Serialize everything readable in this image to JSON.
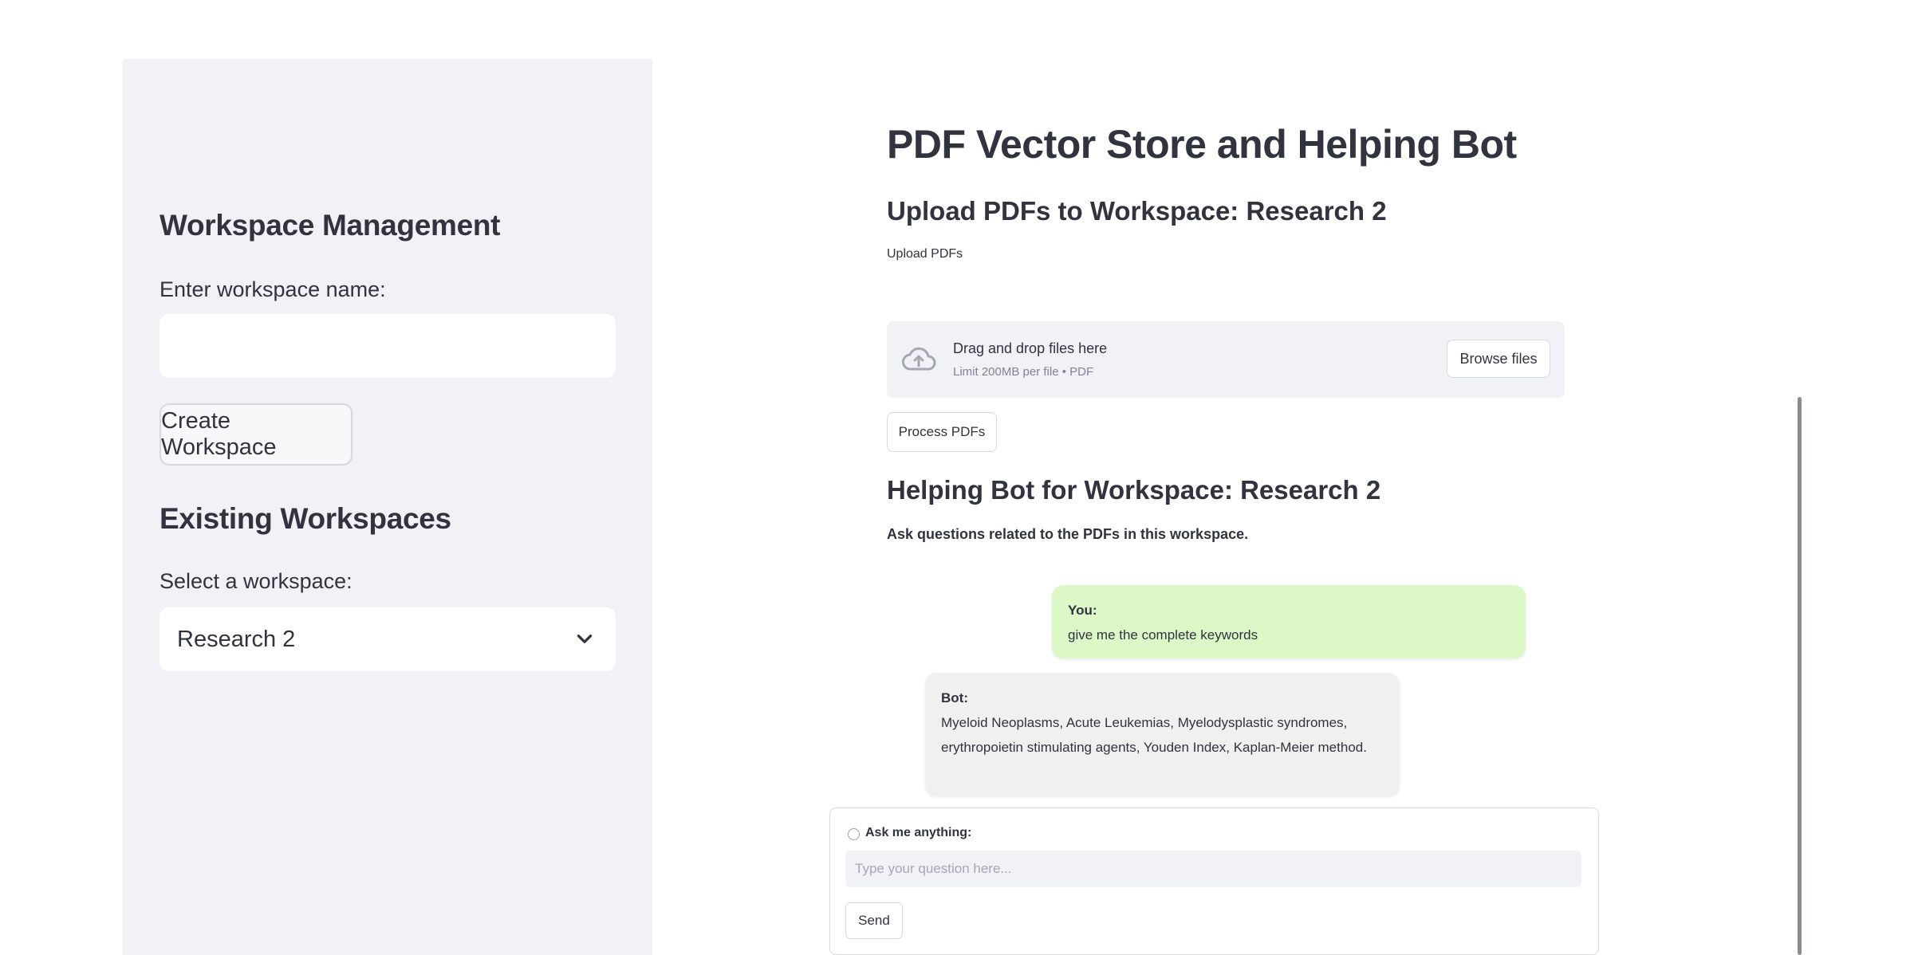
{
  "sidebar": {
    "workspace_heading": "Workspace Management",
    "name_label": "Enter workspace name:",
    "name_value": "",
    "create_button": "Create Workspace",
    "existing_heading": "Existing Workspaces",
    "select_label": "Select a workspace:",
    "selected_workspace": "Research 2"
  },
  "main": {
    "title": "PDF Vector Store and Helping Bot",
    "upload_heading": "Upload PDFs to Workspace: Research 2",
    "upload_label": "Upload PDFs",
    "dropzone": {
      "title": "Drag and drop files here",
      "limit": "Limit 200MB per file • PDF",
      "browse_button": "Browse files",
      "icon": "cloud-upload-icon"
    },
    "process_button": "Process PDFs",
    "bot_heading": "Helping Bot for Workspace: Research 2",
    "bot_description": "Ask questions related to the PDFs in this workspace.",
    "chat": [
      {
        "role": "user",
        "label": "You:",
        "text": "give me the complete keywords"
      },
      {
        "role": "bot",
        "label": "Bot:",
        "text": "Myeloid Neoplasms, Acute Leukemias, Myelodysplastic syndromes, erythropoietin stimulating agents, Youden Index, Kaplan-Meier method."
      }
    ],
    "ask": {
      "label": "Ask me anything:",
      "placeholder": "Type your question here...",
      "send_button": "Send"
    }
  },
  "colors": {
    "sidebar_bg": "#f0f2f6",
    "user_bubble": "#dcf8c6",
    "bot_bubble": "#f1f0f0",
    "text": "#31333f"
  }
}
